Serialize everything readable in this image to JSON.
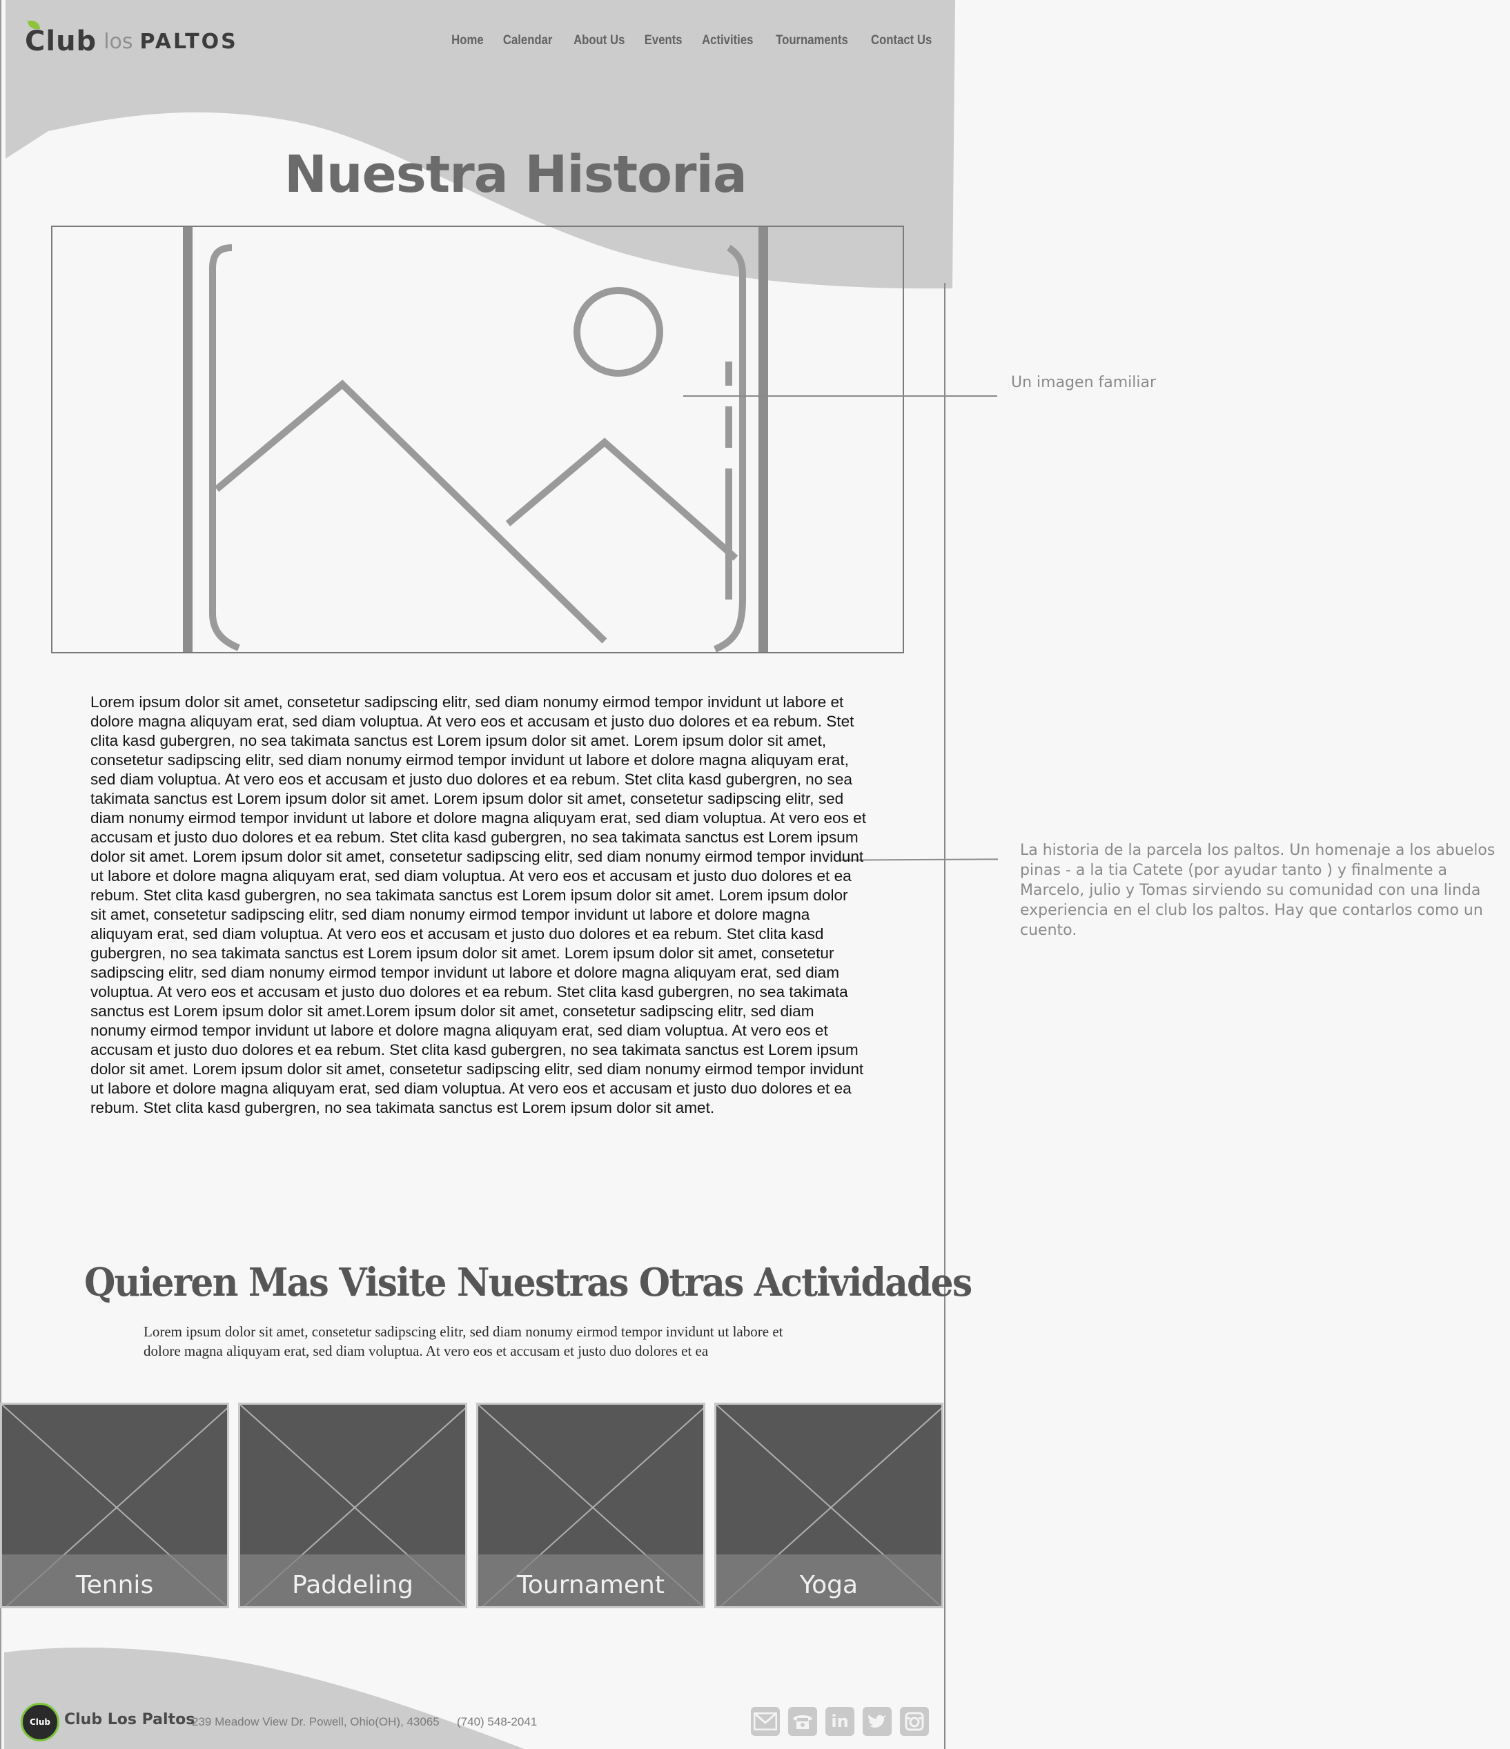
{
  "brand": {
    "logo_club": "Club",
    "logo_los": "los",
    "logo_paltos": "PALTOS"
  },
  "nav": {
    "items": [
      "Home",
      "Calendar",
      "About Us",
      "Events",
      "Activities",
      "Tournaments",
      "Contact Us"
    ]
  },
  "page": {
    "title": "Nuestra Historia"
  },
  "notes": {
    "image_note": "Un imagen familiar",
    "text_note": "La historia de la parcela los paltos. Un homenaje a los abuelos pinas - a la tia Catete (por ayudar tanto ) y finalmente a Marcelo, julio  y Tomas sirviendo su comunidad con una linda experiencia en el club los paltos. Hay que contarlos como un cuento."
  },
  "story": {
    "body": "Lorem ipsum dolor sit amet, consetetur sadipscing elitr, sed diam nonumy eirmod tempor invidunt ut labore et dolore magna aliquyam erat, sed diam voluptua. At vero eos et accusam et justo duo dolores et ea rebum. Stet clita kasd gubergren, no sea takimata sanctus est Lorem ipsum dolor sit amet. Lorem ipsum dolor sit amet, consetetur sadipscing elitr, sed diam nonumy eirmod tempor invidunt ut labore et dolore magna aliquyam erat, sed diam voluptua. At vero eos et accusam et justo duo dolores et ea rebum. Stet clita kasd gubergren, no sea takimata sanctus est Lorem ipsum dolor sit amet. Lorem ipsum dolor sit amet, consetetur sadipscing elitr, sed diam nonumy eirmod tempor invidunt ut labore et dolore magna aliquyam erat, sed diam voluptua. At vero eos et accusam et justo duo dolores et ea rebum. Stet clita kasd gubergren, no sea takimata sanctus est Lorem ipsum dolor sit amet. Lorem ipsum dolor sit amet, consetetur sadipscing elitr, sed diam nonumy eirmod tempor invidunt ut labore et dolore magna aliquyam erat, sed diam voluptua. At vero eos et accusam et justo duo dolores et ea rebum. Stet clita kasd gubergren, no sea takimata sanctus est Lorem ipsum dolor sit amet. Lorem ipsum dolor sit amet, consetetur sadipscing elitr, sed diam nonumy eirmod tempor invidunt ut labore et dolore magna aliquyam erat, sed diam voluptua. At vero eos et accusam et justo duo dolores et ea rebum. Stet clita kasd gubergren, no sea takimata sanctus est Lorem ipsum dolor sit amet. Lorem ipsum dolor sit amet, consetetur sadipscing elitr, sed diam nonumy eirmod tempor invidunt ut labore et dolore magna aliquyam erat, sed diam voluptua. At vero eos et accusam et justo duo dolores et ea rebum. Stet clita kasd gubergren, no sea takimata sanctus est Lorem ipsum dolor sit amet.Lorem ipsum dolor sit amet, consetetur sadipscing elitr, sed diam nonumy eirmod tempor invidunt ut labore et dolore magna aliquyam erat, sed diam voluptua. At vero eos et accusam et justo duo dolores et ea rebum. Stet clita kasd gubergren, no sea takimata sanctus est Lorem ipsum dolor sit amet. Lorem ipsum dolor sit amet, consetetur sadipscing elitr, sed diam nonumy eirmod tempor invidunt ut labore et dolore magna aliquyam erat, sed diam voluptua. At vero eos et accusam et justo duo dolores et ea rebum. Stet clita kasd gubergren, no sea takimata sanctus est Lorem ipsum dolor sit amet."
  },
  "activities": {
    "title": "Quieren Mas Visite Nuestras Otras Actividades",
    "text": "Lorem ipsum dolor sit amet, consetetur sadipscing elitr, sed diam nonumy eirmod tempor invidunt ut labore et dolore magna aliquyam erat, sed diam voluptua. At vero eos et accusam et justo duo dolores et ea",
    "cards": [
      {
        "label": "Tennis"
      },
      {
        "label": "Paddeling"
      },
      {
        "label": "Tournament"
      },
      {
        "label": "Yoga"
      }
    ]
  },
  "footer": {
    "logo_text": "Club",
    "brand": "Club Los Paltos",
    "address": "239 Meadow View Dr. Powell, Ohio(OH), 43065",
    "phone": "(740) 548-2041",
    "social_icons": [
      "mail-icon",
      "phone-icon",
      "linkedin-icon",
      "twitter-icon",
      "instagram-icon"
    ]
  },
  "colors": {
    "header_gray": "#cccccc",
    "card_dark": "#575757",
    "accent_green": "#8cc43c"
  }
}
